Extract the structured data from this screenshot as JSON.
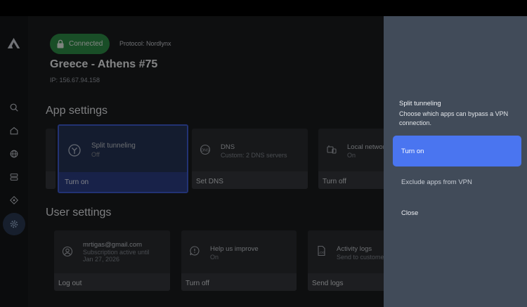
{
  "status": {
    "connection": "Connected",
    "protocol": "Protocol: Nordlynx"
  },
  "server": {
    "name": "Greece - Athens #75",
    "ip": "IP: 156.67.94.158"
  },
  "sidebar": {
    "items": [
      {
        "name": "search",
        "icon": "search-icon"
      },
      {
        "name": "home",
        "icon": "home-icon"
      },
      {
        "name": "countries",
        "icon": "globe-icon"
      },
      {
        "name": "specialty-servers",
        "icon": "servers-icon"
      },
      {
        "name": "meshnet",
        "icon": "meshnet-icon"
      },
      {
        "name": "settings",
        "icon": "gear-icon",
        "active": true
      }
    ]
  },
  "app_settings": {
    "title": "App settings",
    "cards": [
      {
        "id": "split",
        "title": "Split tunneling",
        "sub": "Off",
        "action": "Turn on",
        "icon": "split-tunneling-icon"
      },
      {
        "id": "dns",
        "title": "DNS",
        "sub": "Custom: 2 DNS servers",
        "action": "Set DNS",
        "icon": "dns-icon"
      },
      {
        "id": "lan",
        "title": "Local network",
        "sub": "On",
        "action": "Turn off",
        "icon": "local-network-icon"
      }
    ]
  },
  "user_settings": {
    "title": "User settings",
    "cards": [
      {
        "id": "account",
        "title": "mrtigas@gmail.com",
        "sub": "Subscription active until",
        "sub2": "Jan 27, 2026",
        "action": "Log out",
        "icon": "user-icon"
      },
      {
        "id": "improve",
        "title": "Help us improve",
        "sub": "On",
        "action": "Turn off",
        "icon": "feedback-icon"
      },
      {
        "id": "logs",
        "title": "Activity logs",
        "sub": "Send to customer support",
        "action": "Send logs",
        "icon": "log-icon"
      }
    ]
  },
  "panel": {
    "title": "Split tunneling",
    "description": "Choose which apps can bypass a VPN connection.",
    "buttons": {
      "turn_on": "Turn on",
      "exclude": "Exclude apps from VPN",
      "close": "Close"
    }
  },
  "colors": {
    "accent": "#4a75f0",
    "connected": "#2f8f48",
    "panel": "#414b59"
  }
}
